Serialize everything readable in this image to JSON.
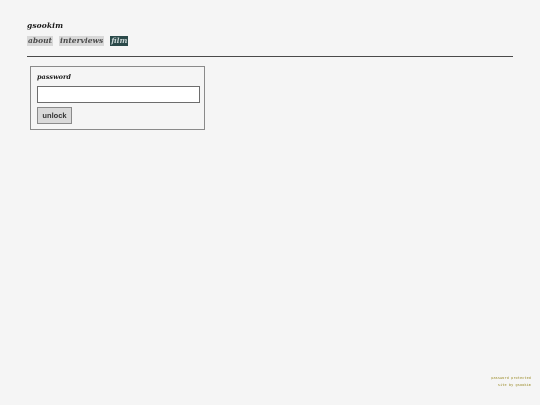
{
  "site": {
    "title": "gsookim"
  },
  "nav": {
    "items": [
      {
        "label": "about",
        "active": false
      },
      {
        "label": "interviews",
        "active": false
      },
      {
        "label": "film",
        "active": true
      }
    ]
  },
  "login": {
    "password_label": "password",
    "password_value": "",
    "password_placeholder": "",
    "unlock_label": "unlock"
  },
  "footer": {
    "line1": "password protected",
    "line2": "site by gsookim"
  },
  "colors": {
    "background": "#f5f5f5",
    "nav_inactive_bg": "#d8d8d8",
    "nav_active_bg": "#2b4a4a",
    "footer_text": "#9a8a25"
  }
}
